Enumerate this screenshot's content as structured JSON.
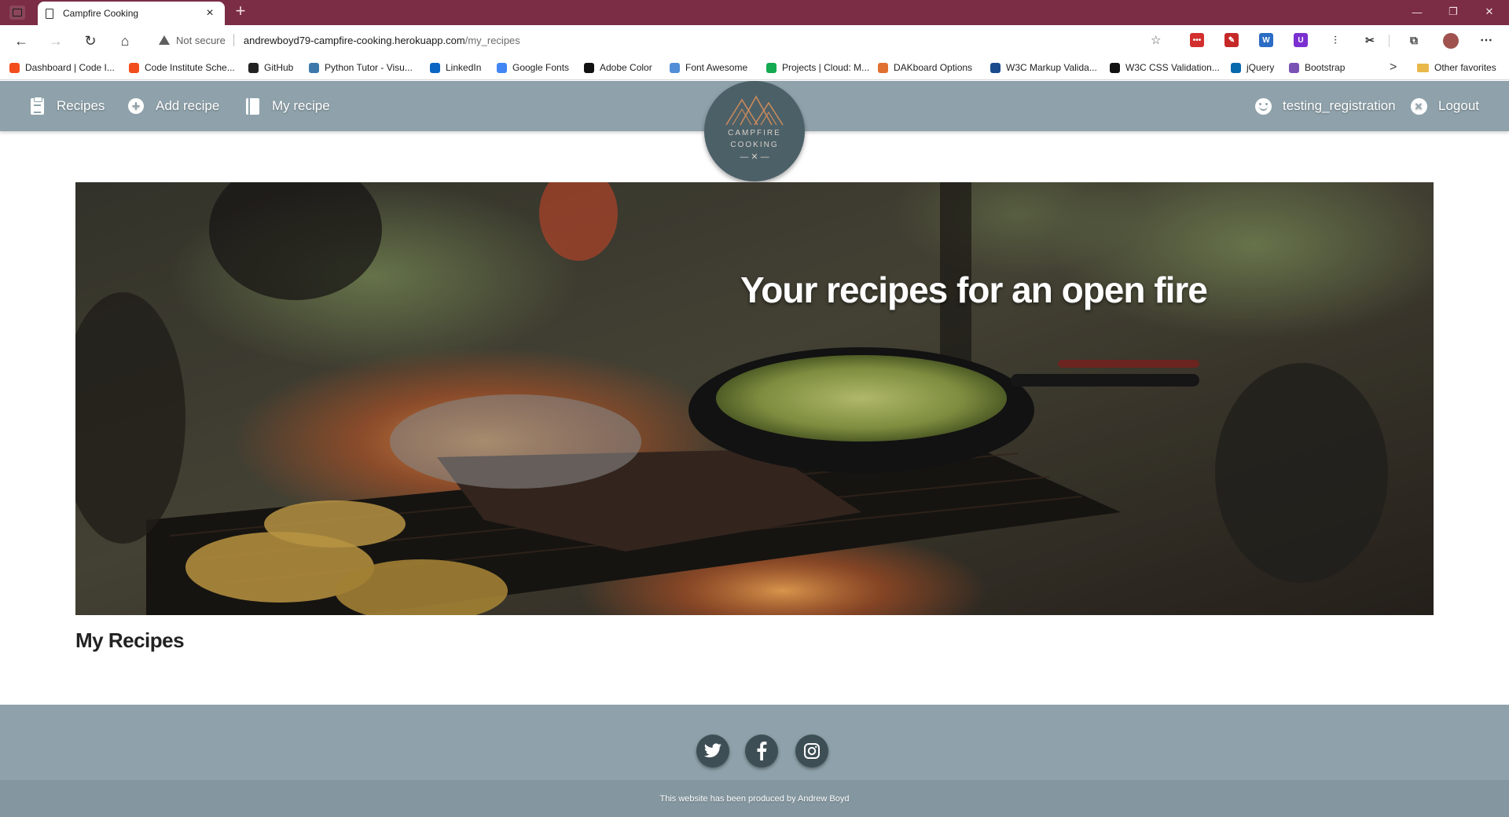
{
  "browser": {
    "tab_title": "Campfire Cooking",
    "tab_close": "×",
    "new_tab": "+",
    "window_controls": {
      "minimize": "—",
      "restore": "❐",
      "close": "✕"
    },
    "nav": {
      "back": "←",
      "forward": "→",
      "reload": "↻",
      "home": "⌂"
    },
    "security_label": "Not secure",
    "url_host": "andrewboyd79-campfire-cooking.herokuapp.com",
    "url_path": "/my_recipes",
    "favorite_star": "☆",
    "more_menu": "⋯",
    "bookmarks": [
      {
        "label": "Dashboard | Code I...",
        "color": "#f24d1c"
      },
      {
        "label": "Code Institute Sche...",
        "color": "#f24d1c"
      },
      {
        "label": "GitHub",
        "color": "#222222"
      },
      {
        "label": "Python Tutor - Visu...",
        "color": "#3c78aa"
      },
      {
        "label": "LinkedIn",
        "color": "#0a66c2"
      },
      {
        "label": "Google Fonts",
        "color": "#4285f4"
      },
      {
        "label": "Adobe Color",
        "color": "#111111"
      },
      {
        "label": "Font Awesome",
        "color": "#528dd7"
      },
      {
        "label": "Projects | Cloud: M...",
        "color": "#13aa52"
      },
      {
        "label": "DAKboard Options",
        "color": "#e07030"
      },
      {
        "label": "W3C Markup Valida...",
        "color": "#1a4b8c"
      },
      {
        "label": "W3C CSS Validation...",
        "color": "#111111"
      },
      {
        "label": "jQuery",
        "color": "#0769ad"
      },
      {
        "label": "Bootstrap",
        "color": "#7952b3"
      }
    ],
    "bookmarks_more": ">",
    "other_favorites": "Other favorites",
    "extensions": [
      {
        "glyph": "•••",
        "color": "#d32f2f"
      },
      {
        "glyph": "✎",
        "color": "#c62828"
      },
      {
        "glyph": "W",
        "color": "#2b6cc4"
      },
      {
        "glyph": "U",
        "color": "#7b2fd0"
      },
      {
        "glyph": "⫶",
        "color": "#555555"
      },
      {
        "glyph": "✂",
        "color": "#333333"
      },
      {
        "glyph": "⧉",
        "color": "#444444"
      }
    ]
  },
  "site": {
    "nav_left": [
      {
        "label": "Recipes",
        "icon": "clipboard-icon"
      },
      {
        "label": "Add recipe",
        "icon": "plus-circle-icon"
      },
      {
        "label": "My recipe",
        "icon": "book-icon"
      }
    ],
    "nav_right": [
      {
        "label": "testing_registration",
        "icon": "user-smile-icon"
      },
      {
        "label": "Logout",
        "icon": "close-circle-icon"
      }
    ],
    "logo_line1": "CAMPFIRE",
    "logo_line2": "COOKING",
    "logo_mark": "—  ✕  —",
    "hero_title": "Your recipes for an open fire",
    "section_title": "My Recipes",
    "social": [
      {
        "name": "twitter",
        "glyph": "🐦"
      },
      {
        "name": "facebook",
        "glyph": "f"
      },
      {
        "name": "instagram",
        "glyph": "◎"
      }
    ],
    "credit": "This website has been produced by Andrew Boyd",
    "colors": {
      "nav": "#8fa2ab",
      "logo": "#4c6068",
      "chrome": "#7b2d45",
      "social": "#3e4e55"
    }
  }
}
